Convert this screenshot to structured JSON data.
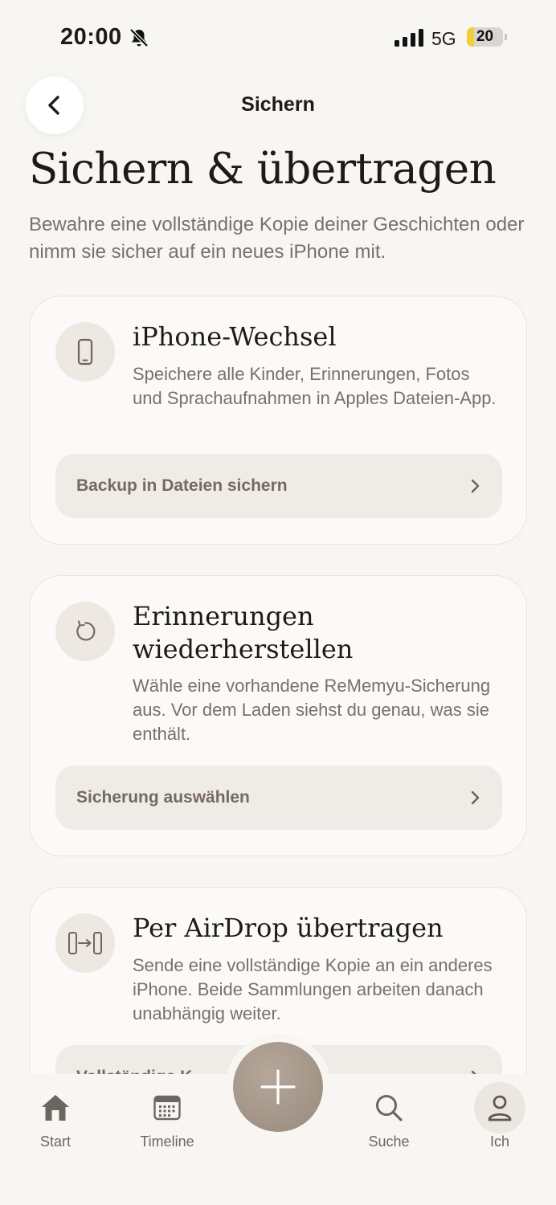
{
  "status_bar": {
    "time": "20:00",
    "network": "5G",
    "battery_level": "20",
    "battery_fraction": 0.2,
    "battery_color": "#f2cc3d"
  },
  "nav": {
    "title": "Sichern",
    "back_icon": "chevron-left-icon"
  },
  "header": {
    "title": "Sichern & übertragen",
    "subtitle": "Bewahre eine vollständige Kopie deiner Geschichten oder nimm sie sicher auf ein neues iPhone mit."
  },
  "cards": [
    {
      "icon": "iphone-icon",
      "title": "iPhone-Wechsel",
      "description": "Speichere alle Kinder, Erinnerungen, Fotos und Sprachaufnahmen in Apples Dateien-App.",
      "action": "Backup in Dateien sichern"
    },
    {
      "icon": "restore-icon",
      "title": "Erinnerungen wiederherstellen",
      "description": "Wähle eine vorhandene ReMemyu-Sicherung aus. Vor dem Laden siehst du genau, was sie enthält.",
      "action": "Sicherung auswählen"
    },
    {
      "icon": "airdrop-transfer-icon",
      "title": "Per AirDrop übertragen",
      "description": "Sende eine vollständige Kopie an ein anderes iPhone. Beide Sammlungen arbeiten danach unabhängig weiter.",
      "action": "Vollständige K"
    }
  ],
  "tab_bar": {
    "tabs": [
      {
        "label": "Start",
        "icon": "home-icon"
      },
      {
        "label": "Timeline",
        "icon": "calendar-icon"
      },
      {
        "label": "Suche",
        "icon": "search-icon"
      },
      {
        "label": "Ich",
        "icon": "person-icon"
      }
    ],
    "add_icon": "plus-icon"
  },
  "colors": {
    "background": "#f8f6f3",
    "accent": "#a89a8d",
    "text_secondary": "#76716b"
  }
}
